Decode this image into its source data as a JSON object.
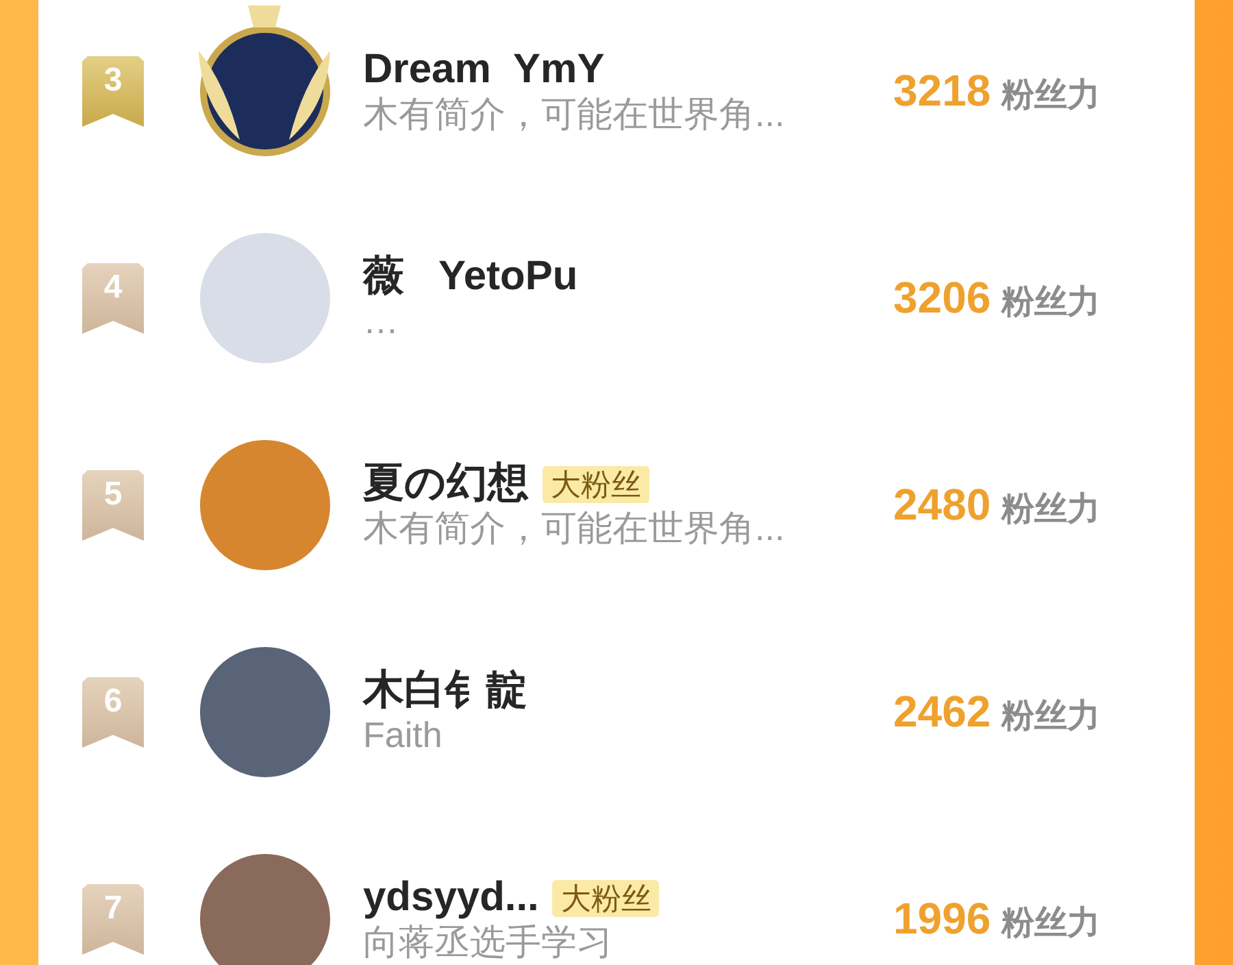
{
  "ranking": [
    {
      "rank": "3",
      "crowned": true,
      "name": "Dream  YmY",
      "description": "木有简介，可能在世界角...",
      "score": "3218",
      "score_unit": "粉丝力"
    },
    {
      "rank": "4",
      "crowned": false,
      "name": "薇   YetoPu",
      "description": "…",
      "score": "3206",
      "score_unit": "粉丝力"
    },
    {
      "rank": "5",
      "crowned": false,
      "name": "夏の幻想",
      "badge": "大粉丝",
      "description": "木有简介，可能在世界角...",
      "score": "2480",
      "score_unit": "粉丝力"
    },
    {
      "rank": "6",
      "crowned": false,
      "name": "木白钅靛",
      "description": "Faith",
      "score": "2462",
      "score_unit": "粉丝力"
    },
    {
      "rank": "7",
      "crowned": false,
      "name": "ydsyyd...",
      "badge": "大粉丝",
      "description": "向蒋丞选手学习",
      "score": "1996",
      "score_unit": "粉丝力"
    }
  ]
}
